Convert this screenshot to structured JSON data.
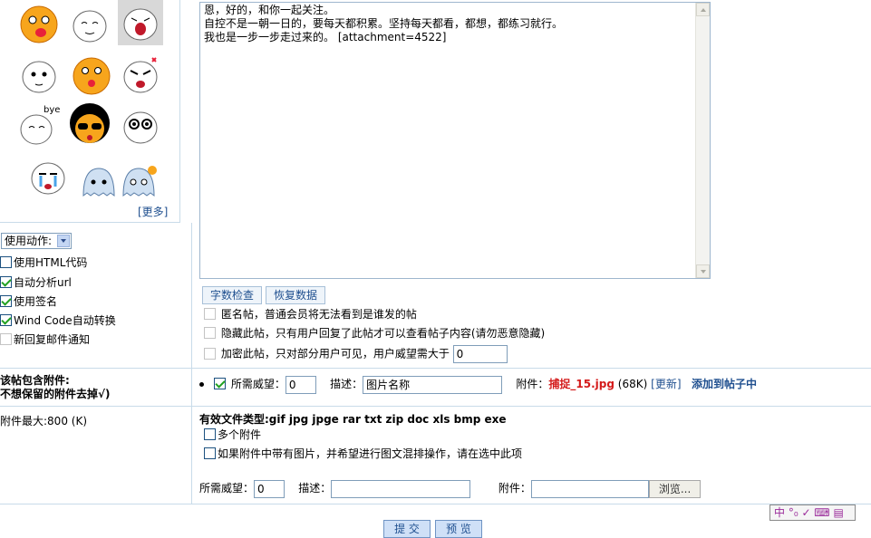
{
  "smilies": {
    "more_label": "[更多]",
    "bye_text": "bye",
    "items": [
      "tongue-face-icon",
      "shy-face-icon",
      "shout-face-icon",
      "sweat-face-icon",
      "wink-face-icon",
      "angry-face-icon",
      "bye-face-icon",
      "cool-face-icon",
      "shock-face-icon",
      "cry-face-icon",
      "ghost-face-icon",
      "ghost-question-icon"
    ]
  },
  "options": {
    "action_select": "使用动作:",
    "html_code": "使用HTML代码",
    "auto_url": "自动分析url",
    "use_sign": "使用签名",
    "windcode": "Wind Code自动转换",
    "reply_mail": "新回复邮件通知"
  },
  "editor": {
    "content": "恩，好的，和你一起关注。\n自控不是一朝一日的，要每天都积累。坚持每天都看，都想，都练习就行。\n我也是一步一步走过来的。 [attachment=4522]"
  },
  "buttons": {
    "word_check": "字数检查",
    "restore": "恢复数据",
    "submit": "提 交",
    "preview": "预 览",
    "browse": "浏览..."
  },
  "post_options": {
    "anonymous": "匿名帖，普通会员将无法看到是谁发的帖",
    "hidden": "隐藏此帖，只有用户回复了此帖才可以查看帖子内容(请勿恶意隐藏)",
    "encrypted": "加密此帖，只对部分用户可见，用户威望需大于",
    "encrypted_value": "0"
  },
  "attachments": {
    "title_line1": "该帖包含附件:",
    "title_line2": "不想保留的附件去掉√)",
    "required_label": "所需威望：",
    "required_value": "0",
    "desc_label": "描述：",
    "desc_value": "图片名称",
    "file_label": "附件：",
    "file_name": "捕捉_15.jpg",
    "file_size": "(68K)",
    "update_link": "[更新]",
    "insert_link": "添加到帖子中"
  },
  "upload": {
    "max_size": "附件最大:800 (K)",
    "file_types": "有效文件类型:gif jpg jpge rar txt zip doc xls bmp exe",
    "multi": "多个附件",
    "mix_text": "如果附件中带有图片，并希望进行图文混排操作，请在选中此项",
    "required_label": "所需威望：",
    "required_value": "0",
    "desc_label": "描述：",
    "file_label": "附件："
  },
  "ime": {
    "text": "中 °₀ ✓ ⌨ ▤"
  },
  "colors": {
    "border": "#c8dbe9",
    "link": "#1f4f8f",
    "filename": "#d41a1a"
  }
}
